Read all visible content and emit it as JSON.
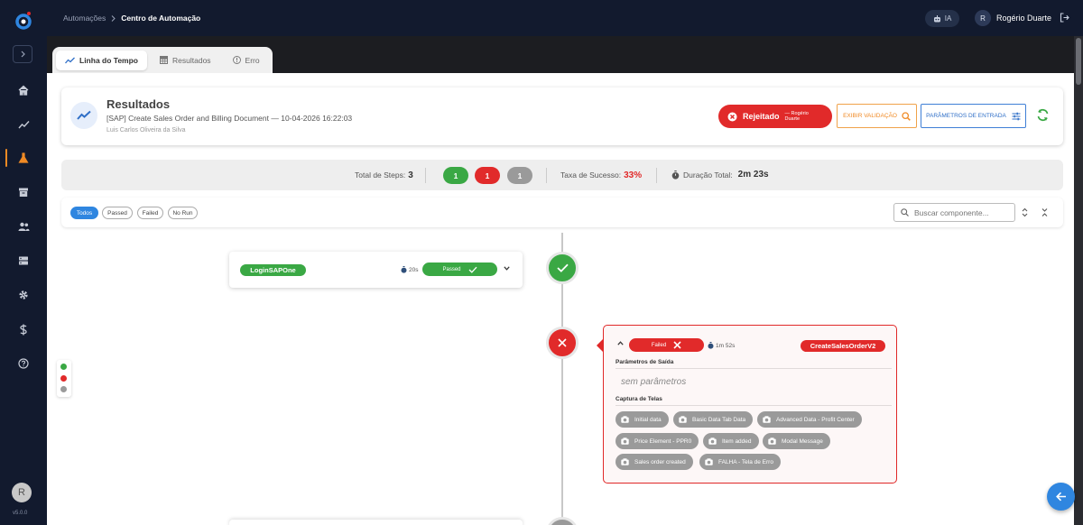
{
  "topbar": {
    "breadcrumb": [
      "Automações",
      "Centro de Automação"
    ],
    "ia_label": "IA",
    "user_initial": "R",
    "user_name": "Rogério Duarte"
  },
  "sidebar": {
    "avatar_initial": "R",
    "version": "v5.0.0",
    "items": [
      "home-icon",
      "trend-icon",
      "flask-icon",
      "archive-icon",
      "users-icon",
      "server-icon",
      "gear-icon",
      "dollar-icon",
      "help-icon"
    ],
    "active_item": "flask-icon"
  },
  "tabs": [
    {
      "label": "Linha do Tempo",
      "icon": "trend-icon",
      "active": true
    },
    {
      "label": "Resultados",
      "icon": "table-icon",
      "active": false
    },
    {
      "label": "Erro",
      "icon": "info-icon",
      "active": false
    }
  ],
  "results": {
    "title": "Resultados",
    "subtitle": "[SAP] Create Sales Order and Billing Document — 10-04-2026 16:22:03",
    "user": "Luis Carlos Oliveira da Silva",
    "status_label": "Rejeitado",
    "status_by": "— Rogério Duarte",
    "btn_validation": "EXIBIR VALIDAÇÃO",
    "btn_params": "PARÂMETROS DE ENTRADA"
  },
  "stats": {
    "total_label": "Total de Steps:",
    "total_value": "3",
    "passed_count": "1",
    "failed_count": "1",
    "norun_count": "1",
    "rate_label": "Taxa de Sucesso:",
    "rate_value": "33%",
    "duration_label": "Duração Total:",
    "duration_value": "2m 23s"
  },
  "filters": {
    "chips": [
      "Todos",
      "Passed",
      "Failed",
      "No Run"
    ],
    "active": "Todos",
    "search_placeholder": "Buscar componente..."
  },
  "steps": [
    {
      "name": "LoginSAPOne",
      "time": "20s",
      "status": "Passed"
    },
    {
      "name": "CreateSalesOrderV2",
      "time": "1m 52s",
      "status": "Failed",
      "output_title": "Parâmetros de Saída",
      "output_empty": "sem parâmetros",
      "screens_title": "Captura de Telas",
      "screens": [
        "Initial data",
        "Basic Data Tab Data",
        "Advanced Data - Profit Center",
        "Price Element - PPR0",
        "Item added",
        "Modal Message",
        "Sales order created",
        "FALHA - Tela de Erro"
      ]
    }
  ],
  "colors": {
    "passed": "#3aa844",
    "failed": "#e12a2a",
    "norun": "#9a9a9a",
    "accent": "#2f86e0",
    "sidebar_bg": "#121a2e",
    "active_marker": "#f08a24"
  }
}
